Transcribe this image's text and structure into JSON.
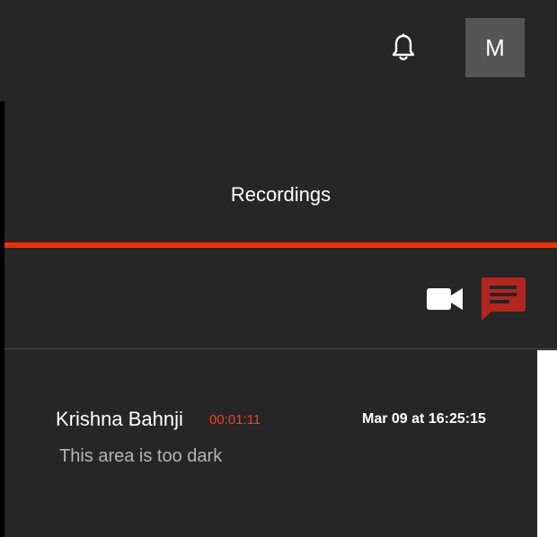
{
  "header": {
    "bell_icon": "bell-icon",
    "avatar_initial": "M"
  },
  "tabs": [
    {
      "label": "Recordings",
      "active": true
    }
  ],
  "toolbar": {
    "video_icon": "video-camera-icon",
    "comment_icon": "comment-icon"
  },
  "comments": [
    {
      "author": "Krishna Bahnji",
      "timecode": "00:01:11",
      "timestamp": "Mar 09 at 16:25:15",
      "text": "This area is too dark"
    }
  ],
  "colors": {
    "background": "#262626",
    "accent": "#ff2a00",
    "timecode": "#ff3b1a",
    "comment_icon": "#b3261e",
    "avatar_bg": "#555555"
  }
}
